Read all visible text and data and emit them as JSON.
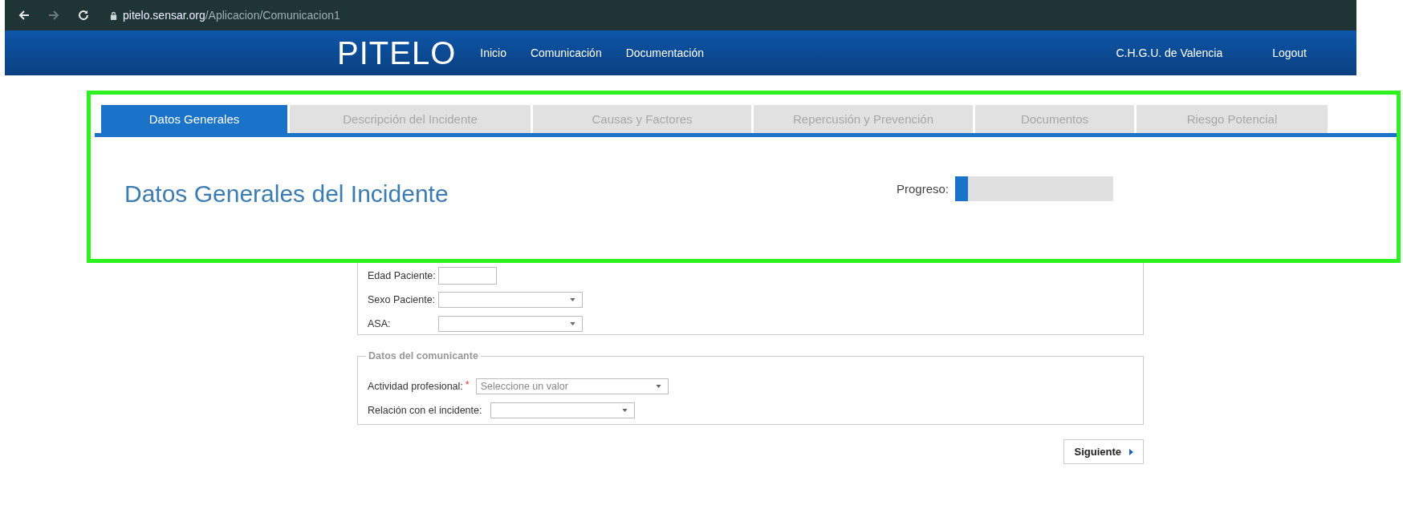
{
  "browser": {
    "url_host": "pitelo.sensar.org",
    "url_path": "/Aplicacion/Comunicacion1"
  },
  "navbar": {
    "brand": "PITELO",
    "links": [
      {
        "label": "Inicio"
      },
      {
        "label": "Comunicación"
      },
      {
        "label": "Documentación"
      }
    ],
    "user": "C.H.G.U. de Valencia",
    "logout": "Logout"
  },
  "tabs": [
    {
      "label": "Datos Generales",
      "selected": true
    },
    {
      "label": "Descripción del Incidente",
      "selected": false
    },
    {
      "label": "Causas y Factores",
      "selected": false
    },
    {
      "label": "Repercusión y Prevención",
      "selected": false
    },
    {
      "label": "Documentos",
      "selected": false
    },
    {
      "label": "Riesgo Potencial",
      "selected": false
    }
  ],
  "heading": "Datos Generales del Incidente",
  "progress": {
    "label": "Progreso:",
    "level": 0.08
  },
  "patient_fields": [
    {
      "label": "Edad Paciente:",
      "kind": "text"
    },
    {
      "label": "Sexo Paciente:",
      "kind": "select"
    },
    {
      "label": "ASA:",
      "kind": "select"
    }
  ],
  "reporter_section": {
    "legend": "Datos del comunicante",
    "fields": [
      {
        "label": "Actividad profesional:",
        "required_mark": "*",
        "kind": "select",
        "placeholder": "Seleccione un valor"
      },
      {
        "label": "Relación con el incidente:",
        "kind": "select"
      }
    ]
  },
  "next_button": {
    "label": "Siguiente"
  }
}
